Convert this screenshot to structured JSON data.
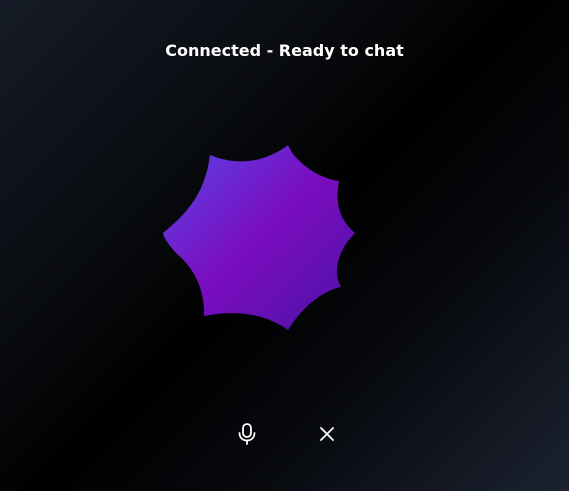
{
  "status": {
    "text": "Connected - Ready to chat"
  },
  "orb": {
    "icon": "voice-orb",
    "colors": {
      "start": "#5a3ee0",
      "mid": "#7a0dbf",
      "end": "#4d10a8"
    }
  },
  "controls": {
    "mic": {
      "icon": "microphone-icon",
      "label": "Microphone"
    },
    "close": {
      "icon": "close-icon",
      "label": "End chat"
    }
  },
  "colors": {
    "text": "#ffffff",
    "background_dark": "#000000",
    "background_edge": "#1b2230"
  }
}
